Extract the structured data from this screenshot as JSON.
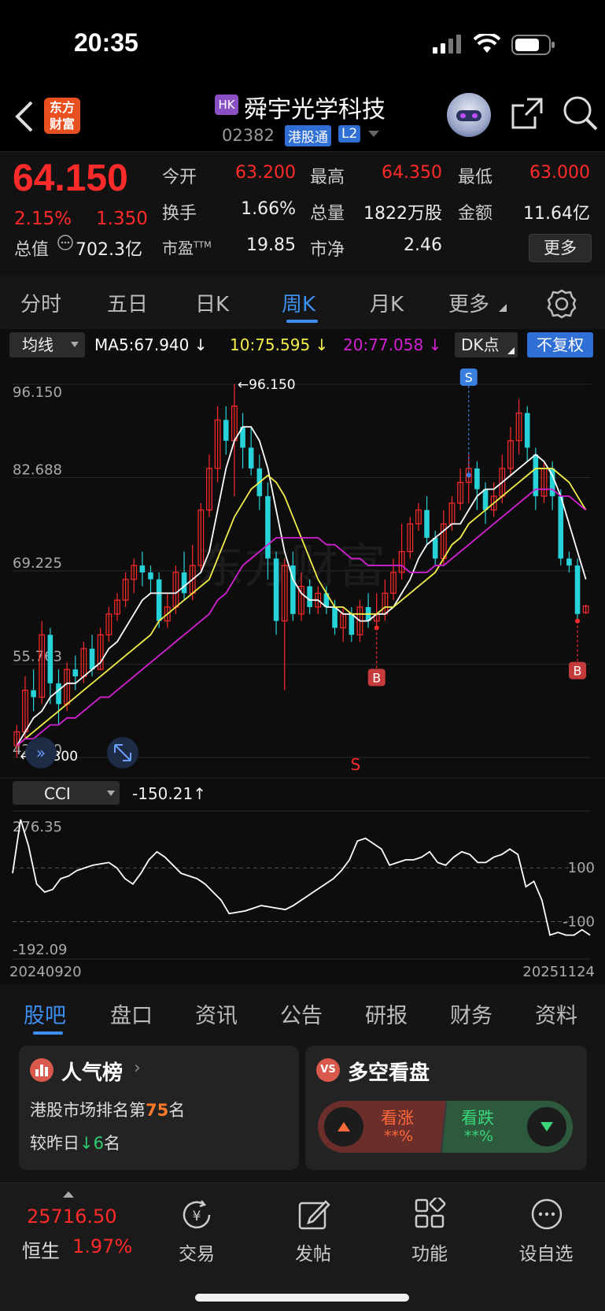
{
  "status_bar": {
    "time": "20:35"
  },
  "header": {
    "logo_line1": "东方",
    "logo_line2": "财富",
    "market_badge": "HK",
    "stock_name": "舜宇光学科技",
    "stock_code": "02382",
    "connect_badge": "港股通",
    "level_badge": "L2"
  },
  "quote": {
    "price": "64.150",
    "change_pct": "2.15%",
    "change_amt": "1.350",
    "open_label": "今开",
    "open_value": "63.200",
    "high_label": "最高",
    "high_value": "64.350",
    "low_label": "最低",
    "low_value": "63.000",
    "turnover_label": "换手",
    "turnover_value": "1.66%",
    "volume_label": "总量",
    "volume_value": "1822万股",
    "amount_label": "金额",
    "amount_value": "11.64亿",
    "mktcap_label": "总值",
    "mktcap_value": "702.3亿",
    "pe_label": "市盈",
    "pe_sup": "TTM",
    "pe_value": "19.85",
    "pb_label": "市净",
    "pb_value": "2.46",
    "more_button": "更多"
  },
  "period_tabs": {
    "tabs": [
      "分时",
      "五日",
      "日K",
      "周K",
      "月K",
      "更多"
    ],
    "active": "周K"
  },
  "chart_toolbar": {
    "indicator": "均线",
    "ma5": "MA5:67.940",
    "ma10": "10:75.595",
    "ma20": "20:77.058",
    "dk_button": "DK点",
    "adjust_button": "不复权"
  },
  "colors": {
    "up": "#ff2a2a",
    "down": "#27d3d9",
    "ma5": "#ffffff",
    "ma10": "#f2ef4a",
    "ma20": "#d321d3",
    "accent": "#3a7ee0"
  },
  "chart_data": {
    "type": "candlestick",
    "price_axis_labels": [
      "96.150",
      "82.688",
      "69.225",
      "55.763",
      "42.300"
    ],
    "ylim": [
      42.3,
      96.15
    ],
    "max_marker": "←96.150",
    "min_marker": "←42.300",
    "signal_labels": {
      "sell": "S",
      "buy": "B",
      "s_text": "S"
    },
    "candles": [
      {
        "o": 44,
        "c": 46,
        "h": 47,
        "l": 42.3
      },
      {
        "o": 46,
        "c": 52,
        "h": 54,
        "l": 45
      },
      {
        "o": 52,
        "c": 51,
        "h": 55,
        "l": 49
      },
      {
        "o": 51,
        "c": 60,
        "h": 62,
        "l": 50
      },
      {
        "o": 60,
        "c": 53,
        "h": 61,
        "l": 50
      },
      {
        "o": 53,
        "c": 50,
        "h": 55,
        "l": 47
      },
      {
        "o": 50,
        "c": 55,
        "h": 56,
        "l": 49
      },
      {
        "o": 55,
        "c": 54,
        "h": 57,
        "l": 52
      },
      {
        "o": 54,
        "c": 58,
        "h": 59,
        "l": 53
      },
      {
        "o": 58,
        "c": 55,
        "h": 60,
        "l": 54
      },
      {
        "o": 55,
        "c": 60,
        "h": 61,
        "l": 55
      },
      {
        "o": 60,
        "c": 63,
        "h": 64,
        "l": 59
      },
      {
        "o": 63,
        "c": 65,
        "h": 66,
        "l": 62
      },
      {
        "o": 65,
        "c": 68,
        "h": 69,
        "l": 64
      },
      {
        "o": 68,
        "c": 70,
        "h": 71,
        "l": 66
      },
      {
        "o": 70,
        "c": 69,
        "h": 72,
        "l": 67
      },
      {
        "o": 69,
        "c": 68,
        "h": 70,
        "l": 66
      },
      {
        "o": 68,
        "c": 62,
        "h": 69,
        "l": 61
      },
      {
        "o": 62,
        "c": 64,
        "h": 66,
        "l": 61
      },
      {
        "o": 64,
        "c": 69,
        "h": 70,
        "l": 63
      },
      {
        "o": 69,
        "c": 66,
        "h": 72,
        "l": 65
      },
      {
        "o": 66,
        "c": 70,
        "h": 73,
        "l": 65
      },
      {
        "o": 70,
        "c": 78,
        "h": 79,
        "l": 69
      },
      {
        "o": 78,
        "c": 84,
        "h": 86,
        "l": 77
      },
      {
        "o": 84,
        "c": 91,
        "h": 93,
        "l": 82
      },
      {
        "o": 91,
        "c": 88,
        "h": 93,
        "l": 86
      },
      {
        "o": 88,
        "c": 93,
        "h": 96.15,
        "l": 80
      },
      {
        "o": 90,
        "c": 87,
        "h": 92,
        "l": 84
      },
      {
        "o": 87,
        "c": 84,
        "h": 90,
        "l": 83
      },
      {
        "o": 84,
        "c": 80,
        "h": 86,
        "l": 78
      },
      {
        "o": 80,
        "c": 71,
        "h": 82,
        "l": 68
      },
      {
        "o": 71,
        "c": 62,
        "h": 72,
        "l": 60
      },
      {
        "o": 62,
        "c": 70,
        "h": 71,
        "l": 52
      },
      {
        "o": 70,
        "c": 63,
        "h": 72,
        "l": 62
      },
      {
        "o": 63,
        "c": 67,
        "h": 69,
        "l": 62
      },
      {
        "o": 67,
        "c": 64,
        "h": 68,
        "l": 63
      },
      {
        "o": 64,
        "c": 66,
        "h": 67,
        "l": 63
      },
      {
        "o": 66,
        "c": 64,
        "h": 67,
        "l": 63
      },
      {
        "o": 64,
        "c": 61,
        "h": 65,
        "l": 60
      },
      {
        "o": 61,
        "c": 63,
        "h": 64,
        "l": 59
      },
      {
        "o": 63,
        "c": 60,
        "h": 64,
        "l": 59
      },
      {
        "o": 60,
        "c": 64,
        "h": 65,
        "l": 59
      },
      {
        "o": 64,
        "c": 62,
        "h": 66,
        "l": 61
      },
      {
        "o": 62,
        "c": 63,
        "h": 66,
        "l": 61
      },
      {
        "o": 63,
        "c": 66,
        "h": 68,
        "l": 62
      },
      {
        "o": 66,
        "c": 69,
        "h": 71,
        "l": 65
      },
      {
        "o": 69,
        "c": 72,
        "h": 76,
        "l": 68
      },
      {
        "o": 72,
        "c": 76,
        "h": 77,
        "l": 71
      },
      {
        "o": 76,
        "c": 78,
        "h": 79,
        "l": 75
      },
      {
        "o": 78,
        "c": 74,
        "h": 80,
        "l": 73
      },
      {
        "o": 74,
        "c": 71,
        "h": 75,
        "l": 70
      },
      {
        "o": 71,
        "c": 76,
        "h": 78,
        "l": 70
      },
      {
        "o": 76,
        "c": 79,
        "h": 80,
        "l": 75
      },
      {
        "o": 79,
        "c": 82,
        "h": 84,
        "l": 78
      },
      {
        "o": 82,
        "c": 84,
        "h": 86,
        "l": 79
      },
      {
        "o": 84,
        "c": 81,
        "h": 85,
        "l": 78
      },
      {
        "o": 81,
        "c": 78,
        "h": 82,
        "l": 76
      },
      {
        "o": 78,
        "c": 80,
        "h": 82,
        "l": 77
      },
      {
        "o": 80,
        "c": 84,
        "h": 86,
        "l": 79
      },
      {
        "o": 84,
        "c": 88,
        "h": 90,
        "l": 83
      },
      {
        "o": 88,
        "c": 92,
        "h": 94,
        "l": 86
      },
      {
        "o": 92,
        "c": 87,
        "h": 93,
        "l": 85
      },
      {
        "o": 86,
        "c": 80,
        "h": 87,
        "l": 78
      },
      {
        "o": 80,
        "c": 84,
        "h": 85,
        "l": 79
      },
      {
        "o": 84,
        "c": 80,
        "h": 85,
        "l": 78
      },
      {
        "o": 80,
        "c": 71,
        "h": 81,
        "l": 70
      },
      {
        "o": 71,
        "c": 70,
        "h": 72,
        "l": 69
      },
      {
        "o": 70,
        "c": 63,
        "h": 71,
        "l": 62
      },
      {
        "o": 63.2,
        "c": 64.15,
        "h": 64.35,
        "l": 63
      }
    ],
    "ma5": [
      44,
      46,
      48,
      49,
      51,
      52,
      53,
      53,
      54,
      55,
      56,
      58,
      59,
      61,
      63,
      65,
      66,
      66,
      66,
      66,
      67,
      68,
      69,
      72,
      78,
      84,
      88,
      90,
      90,
      88,
      84,
      78,
      72,
      68,
      66,
      65,
      65,
      64,
      64,
      63,
      63,
      62,
      62,
      63,
      63,
      64,
      66,
      68,
      71,
      73,
      74,
      75,
      76,
      76,
      78,
      80,
      81,
      81,
      82,
      83,
      84,
      85,
      86,
      85,
      83,
      80,
      76,
      72,
      68
    ],
    "ma10": [
      44,
      45,
      46,
      47,
      48,
      49,
      50,
      51,
      52,
      53,
      54,
      55,
      56,
      57,
      58,
      59,
      60,
      62,
      63,
      64,
      65,
      66,
      67,
      68,
      71,
      74,
      77,
      79,
      81,
      82,
      83,
      82,
      80,
      77,
      74,
      71,
      68,
      66,
      64,
      64,
      63,
      63,
      63,
      63,
      64,
      64,
      65,
      66,
      67,
      68,
      69,
      71,
      73,
      74,
      76,
      77,
      78,
      79,
      80,
      81,
      82,
      83,
      84,
      84,
      84,
      83,
      82,
      80,
      78
    ],
    "ma20": [
      44,
      45,
      45,
      46,
      47,
      47,
      48,
      48,
      49,
      50,
      51,
      51,
      52,
      53,
      54,
      55,
      56,
      57,
      58,
      59,
      60,
      61,
      62,
      63,
      65,
      66,
      68,
      70,
      71,
      72,
      73,
      74,
      74,
      74,
      74,
      74,
      74,
      73,
      73,
      72,
      71,
      71,
      70,
      70,
      70,
      70,
      70,
      69,
      69,
      69,
      70,
      70,
      71,
      72,
      73,
      74,
      75,
      76,
      77,
      78,
      79,
      80,
      81,
      81,
      81,
      80,
      80,
      79,
      78
    ],
    "signals": [
      {
        "type": "S",
        "index": 54
      },
      {
        "type": "B",
        "index": 43
      },
      {
        "type": "B",
        "index": 67
      }
    ]
  },
  "cci": {
    "indicator": "CCI",
    "value": "-150.21",
    "max_label": "276.35",
    "min_label": "-192.09",
    "line100": "100",
    "line_neg100": "-100",
    "date_start": "20240920",
    "date_end": "20251124",
    "values": [
      80,
      280,
      180,
      40,
      10,
      20,
      60,
      70,
      90,
      100,
      110,
      115,
      120,
      100,
      60,
      40,
      80,
      130,
      160,
      140,
      110,
      80,
      70,
      60,
      40,
      10,
      -20,
      -70,
      -65,
      -60,
      -50,
      -40,
      -45,
      -50,
      -55,
      -40,
      -20,
      0,
      20,
      40,
      60,
      90,
      130,
      200,
      210,
      190,
      170,
      110,
      120,
      130,
      130,
      140,
      160,
      120,
      110,
      140,
      160,
      150,
      120,
      120,
      140,
      150,
      170,
      150,
      30,
      50,
      -20,
      -150,
      -140,
      -150,
      -150,
      -130,
      -150
    ]
  },
  "bottom_tabs": {
    "tabs": [
      "股吧",
      "盘口",
      "资讯",
      "公告",
      "研报",
      "财务",
      "资料"
    ],
    "active": "股吧"
  },
  "popularity_card": {
    "title": "人气榜",
    "rank_prefix": "港股市场排名第",
    "rank_value": "75",
    "rank_suffix": "名",
    "change_prefix": "较昨日",
    "change_value": "6",
    "change_suffix": "名"
  },
  "sentiment_card": {
    "title": "多空看盘",
    "bull_label": "看涨",
    "bull_value": "**%",
    "bear_label": "看跌",
    "bear_value": "**%"
  },
  "nav": {
    "index_value": "25716.50",
    "index_name": "恒生",
    "index_change": "1.97%",
    "items": [
      "交易",
      "发帖",
      "功能",
      "设自选"
    ]
  }
}
